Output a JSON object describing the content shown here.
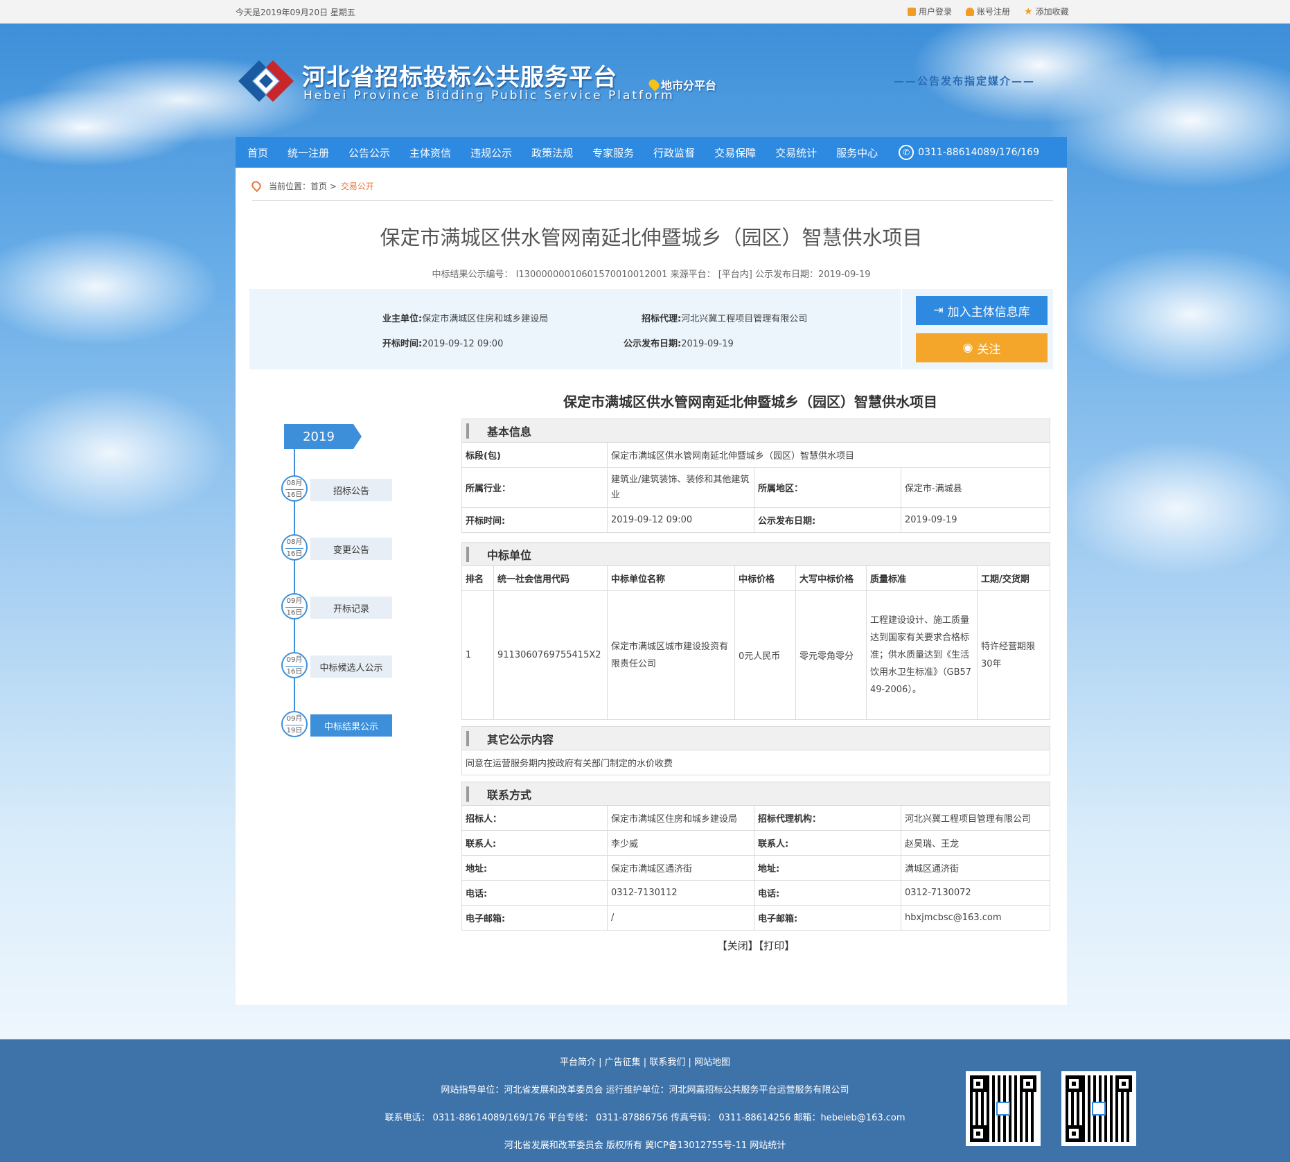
{
  "topbar": {
    "date": "今天是2019年09月20日 星期五",
    "login": "用户登录",
    "register": "账号注册",
    "favorite": "添加收藏"
  },
  "header": {
    "title": "河北省招标投标公共服务平台",
    "subtitle": "Hebei Province Bidding Public Service Platform",
    "city": "地市分平台",
    "media": "——公告发布指定媒介——"
  },
  "nav": {
    "items": [
      "首页",
      "统一注册",
      "公告公示",
      "主体资信",
      "违规公示",
      "政策法规",
      "专家服务",
      "行政监督",
      "交易保障",
      "交易统计",
      "服务中心"
    ],
    "phone": "0311-88614089/176/169"
  },
  "breadcrumb": {
    "prefix": "当前位置：首页 >",
    "current": "交易公开"
  },
  "notice": {
    "title": "保定市满城区供水管网南延北伸暨城乡（园区）智慧供水项目",
    "meta": "中标结果公示编号： I13000000010601570010012001   来源平台： [平台内]   公示发布日期：2019-09-19",
    "owner_label": "业主单位:",
    "owner": "保定市满城区住房和城乡建设局",
    "agent_label": "招标代理:",
    "agent": "河北兴冀工程项目管理有限公司",
    "open_label": "开标时间:",
    "open_time": "2019-09-12 09:00",
    "publish_label": "公示发布日期:",
    "publish_date": "2019-09-19",
    "btn_add": "加入主体信息库",
    "btn_follow": "关注",
    "subtitle": "保定市满城区供水管网南延北伸暨城乡（园区）智慧供水项目"
  },
  "timeline": {
    "year": "2019",
    "nodes": [
      {
        "month": "08月",
        "day": "16日",
        "label": "招标公告"
      },
      {
        "month": "08月",
        "day": "16日",
        "label": "变更公告"
      },
      {
        "month": "09月",
        "day": "16日",
        "label": "开标记录"
      },
      {
        "month": "09月",
        "day": "16日",
        "label": "中标候选人公示"
      },
      {
        "month": "09月",
        "day": "19日",
        "label": "中标结果公示"
      }
    ]
  },
  "basic": {
    "section": "基本信息",
    "section_label": "标段(包)",
    "section_value": "保定市满城区供水管网南延北伸暨城乡（园区）智慧供水项目",
    "industry_label": "所属行业：",
    "industry": "建筑业/建筑装饰、装修和其他建筑业",
    "region_label": "所属地区：",
    "region": "保定市-满城县",
    "open_label": "开标时间:",
    "open_time": "2019-09-12 09:00",
    "publish_label": "公示发布日期:",
    "publish_date": "2019-09-19"
  },
  "winner": {
    "section": "中标单位",
    "headers": [
      "排名",
      "统一社会信用代码",
      "中标单位名称",
      "中标价格",
      "大写中标价格",
      "质量标准",
      "工期/交货期"
    ],
    "rank": "1",
    "credit_code": "9113060769755415X2",
    "name": "保定市满城区城市建设投资有限责任公司",
    "price": "0元人民币",
    "price_upper": "零元零角零分",
    "quality": "工程建设设计、施工质量达到国家有关要求合格标准；供水质量达到《生活饮用水卫生标准》（GB5749-2006）。",
    "period": "特许经营期限30年"
  },
  "other": {
    "section": "其它公示内容",
    "content": "同意在运营服务期内按政府有关部门制定的水价收费"
  },
  "contact": {
    "section": "联系方式",
    "rows": [
      {
        "k1": "招标人：",
        "v1": "保定市满城区住房和城乡建设局",
        "k2": "招标代理机构：",
        "v2": "河北兴冀工程项目管理有限公司"
      },
      {
        "k1": "联系人:",
        "v1": "李少威",
        "k2": "联系人:",
        "v2": "赵昊瑞、王龙"
      },
      {
        "k1": "地址:",
        "v1": "保定市满城区通济街",
        "k2": "地址:",
        "v2": "满城区通济街"
      },
      {
        "k1": "电话:",
        "v1": "0312-7130112",
        "k2": "电话:",
        "v2": "0312-7130072"
      },
      {
        "k1": "电子邮箱:",
        "v1": "/",
        "k2": "电子邮箱:",
        "v2": "hbxjmcbsc@163.com"
      }
    ]
  },
  "actions": {
    "close": "【关闭】",
    "print": "【打印】"
  },
  "footer": {
    "links": "平台简介   |   广告征集   |   联系我们   |   网站地图",
    "guide": "网站指导单位：河北省发展和改革委员会    运行维护单位：河北网嘉招标公共服务平台运营服务有限公司",
    "contact": "联系电话： 0311-88614089/169/176    平台专线： 0311-87886756    传真号码： 0311-88614256    邮箱：hebeieb@163.com",
    "copyright": "河北省发展和改革委员会 版权所有    冀ICP备13012755号-11    网站统计"
  },
  "colors": {
    "nav": "#2d8ae0",
    "follow": "#f4a62a",
    "footer": "#3e73aa",
    "accent_orange": "#e8763a"
  }
}
